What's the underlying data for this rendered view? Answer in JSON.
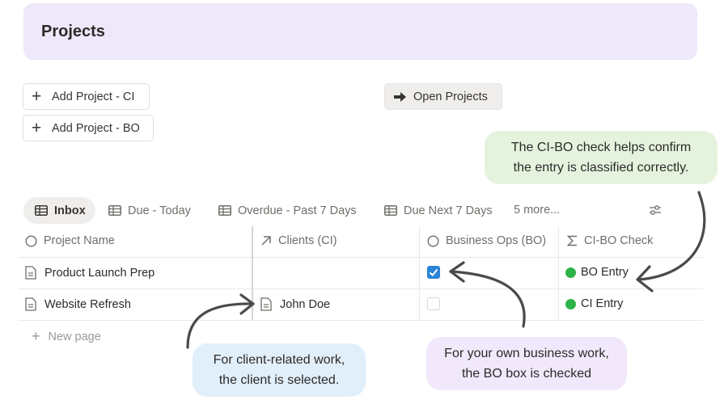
{
  "header": {
    "title": "Projects",
    "bg_color": "#eee8fa"
  },
  "buttons": {
    "add_ci": "Add Project - CI",
    "add_bo": "Add Project - BO",
    "open_projects": "Open Projects"
  },
  "callouts": {
    "green": {
      "line1": "The CI-BO check helps confirm",
      "line2": "the entry is classified correctly."
    },
    "blue": {
      "line1": "For client-related work,",
      "line2": "the client is selected."
    },
    "purple": {
      "line1": "For your own business work,",
      "line2": "the BO box is checked"
    }
  },
  "tabs": [
    {
      "label": "Inbox",
      "active": true,
      "icon": "table-icon"
    },
    {
      "label": "Due - Today",
      "active": false,
      "icon": "table-icon"
    },
    {
      "label": "Overdue - Past 7 Days",
      "active": false,
      "icon": "table-icon"
    },
    {
      "label": "Due Next 7 Days",
      "active": false,
      "icon": "table-icon"
    }
  ],
  "more_tabs": "5 more...",
  "table": {
    "columns": [
      {
        "label": "Project Name",
        "icon": "circle-icon"
      },
      {
        "label": "Clients (CI)",
        "icon": "relation-arrow-icon"
      },
      {
        "label": "Business Ops (BO)",
        "icon": "circle-icon"
      },
      {
        "label": "CI-BO Check",
        "icon": "sigma-icon"
      }
    ],
    "rows": [
      {
        "name": "Product Launch Prep",
        "client": "",
        "bo_checked": true,
        "check": "BO Entry",
        "check_color": "#2eb34a"
      },
      {
        "name": "Website Refresh",
        "client": "John Doe",
        "bo_checked": false,
        "check": "CI Entry",
        "check_color": "#2eb34a"
      }
    ],
    "new_page": "New page"
  },
  "colors": {
    "accent": "#2a83d8",
    "text": "#37352f",
    "muted": "#6f6e69"
  }
}
